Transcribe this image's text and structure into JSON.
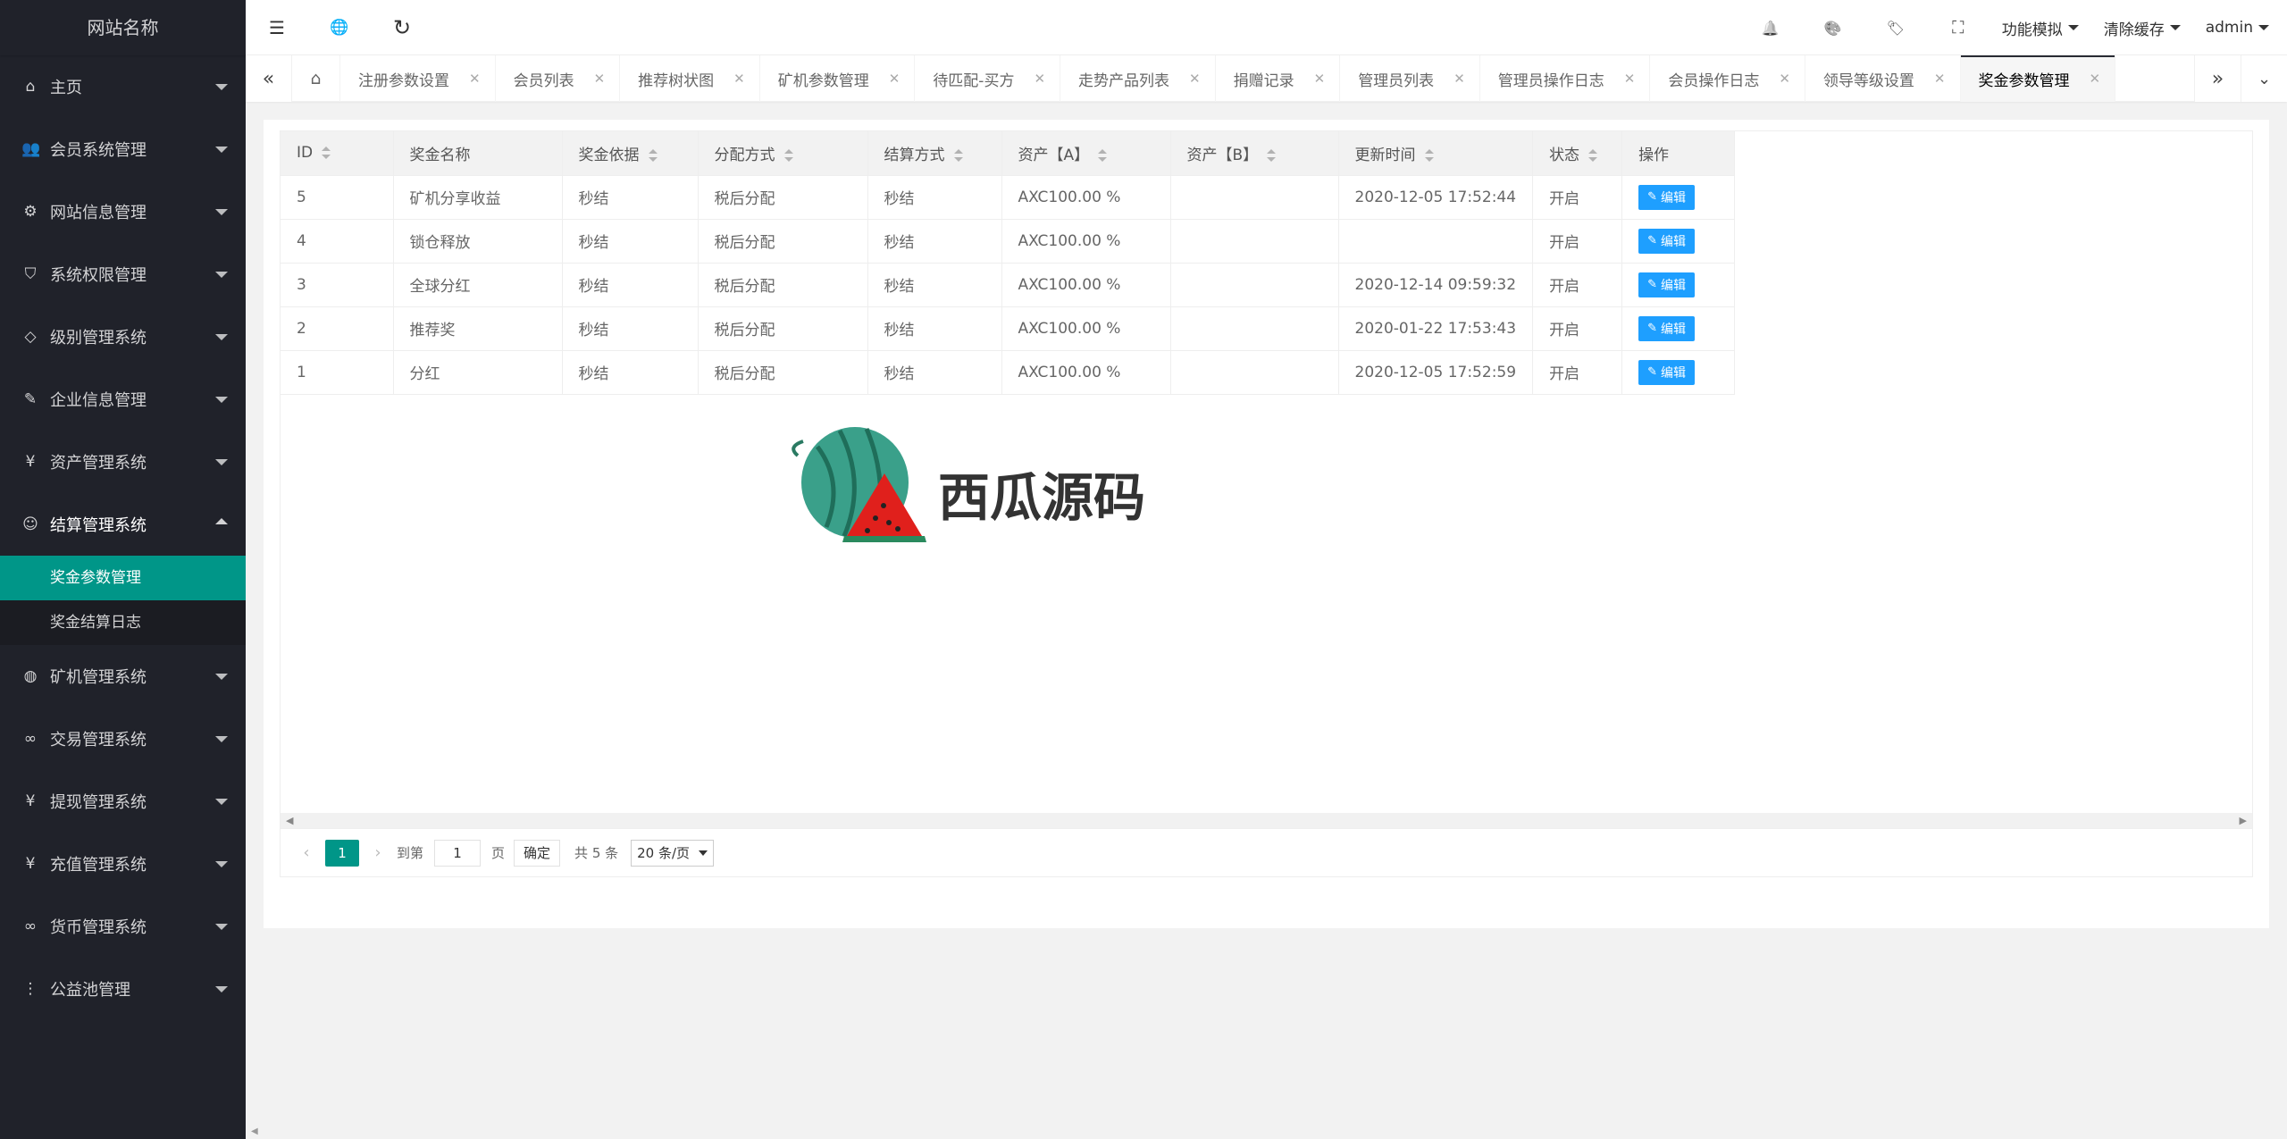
{
  "sidebar": {
    "logo": "网站名称",
    "items": [
      {
        "label": "主页",
        "icon": "⌂"
      },
      {
        "label": "会员系统管理",
        "icon": "👥"
      },
      {
        "label": "网站信息管理",
        "icon": "⚙"
      },
      {
        "label": "系统权限管理",
        "icon": "⛉"
      },
      {
        "label": "级别管理系统",
        "icon": "◇"
      },
      {
        "label": "企业信息管理",
        "icon": "✎"
      },
      {
        "label": "资产管理系统",
        "icon": "¥"
      },
      {
        "label": "结算管理系统",
        "icon": "☺"
      }
    ],
    "submenu": [
      {
        "label": "奖金参数管理"
      },
      {
        "label": "奖金结算日志"
      }
    ],
    "items_after": [
      {
        "label": "矿机管理系统",
        "icon": "◍"
      },
      {
        "label": "交易管理系统",
        "icon": "∞"
      },
      {
        "label": "提现管理系统",
        "icon": "¥"
      },
      {
        "label": "充值管理系统",
        "icon": "¥"
      },
      {
        "label": "货币管理系统",
        "icon": "∞"
      },
      {
        "label": "公益池管理",
        "icon": "⋮"
      }
    ]
  },
  "header": {
    "icons": [
      "☰",
      "🌐",
      "↻"
    ],
    "right_icons": [
      "🔔",
      "🎨",
      "🏷",
      "⛶"
    ],
    "menus": [
      "功能模拟",
      "清除缓存",
      "admin"
    ]
  },
  "tabs": [
    {
      "label": "注册参数设置"
    },
    {
      "label": "会员列表"
    },
    {
      "label": "推荐树状图"
    },
    {
      "label": "矿机参数管理"
    },
    {
      "label": "待匹配-买方"
    },
    {
      "label": "走势产品列表"
    },
    {
      "label": "捐赠记录"
    },
    {
      "label": "管理员列表"
    },
    {
      "label": "管理员操作日志"
    },
    {
      "label": "会员操作日志"
    },
    {
      "label": "领导等级设置"
    },
    {
      "label": "奖金参数管理"
    }
  ],
  "table": {
    "columns": [
      "ID",
      "奖金名称",
      "奖金依据",
      "分配方式",
      "结算方式",
      "资产【A】",
      "资产【B】",
      "更新时间",
      "状态",
      "操作"
    ],
    "rows": [
      {
        "id": "5",
        "name": "矿机分享收益",
        "basis": "秒结",
        "dist": "税后分配",
        "settle": "秒结",
        "asset_a": "AXC100.00 %",
        "asset_b": "",
        "time": "2020-12-05 17:52:44",
        "status": "开启"
      },
      {
        "id": "4",
        "name": "锁仓释放",
        "basis": "秒结",
        "dist": "税后分配",
        "settle": "秒结",
        "asset_a": "AXC100.00 %",
        "asset_b": "",
        "time": "",
        "status": "开启"
      },
      {
        "id": "3",
        "name": "全球分红",
        "basis": "秒结",
        "dist": "税后分配",
        "settle": "秒结",
        "asset_a": "AXC100.00 %",
        "asset_b": "",
        "time": "2020-12-14 09:59:32",
        "status": "开启"
      },
      {
        "id": "2",
        "name": "推荐奖",
        "basis": "秒结",
        "dist": "税后分配",
        "settle": "秒结",
        "asset_a": "AXC100.00 %",
        "asset_b": "",
        "time": "2020-01-22 17:53:43",
        "status": "开启"
      },
      {
        "id": "1",
        "name": "分红",
        "basis": "秒结",
        "dist": "税后分配",
        "settle": "秒结",
        "asset_a": "AXC100.00 %",
        "asset_b": "",
        "time": "2020-12-05 17:52:59",
        "status": "开启"
      }
    ],
    "edit_label": "编辑"
  },
  "pager": {
    "current": "1",
    "goto_label": "到第",
    "page_value": "1",
    "page_suffix": "页",
    "confirm": "确定",
    "total": "共 5 条",
    "page_size": "20 条/页"
  },
  "watermark": {
    "text": "西瓜源码"
  },
  "colors": {
    "sidebar": "#20222a",
    "accent": "#009688",
    "edit": "#1e9fff"
  }
}
